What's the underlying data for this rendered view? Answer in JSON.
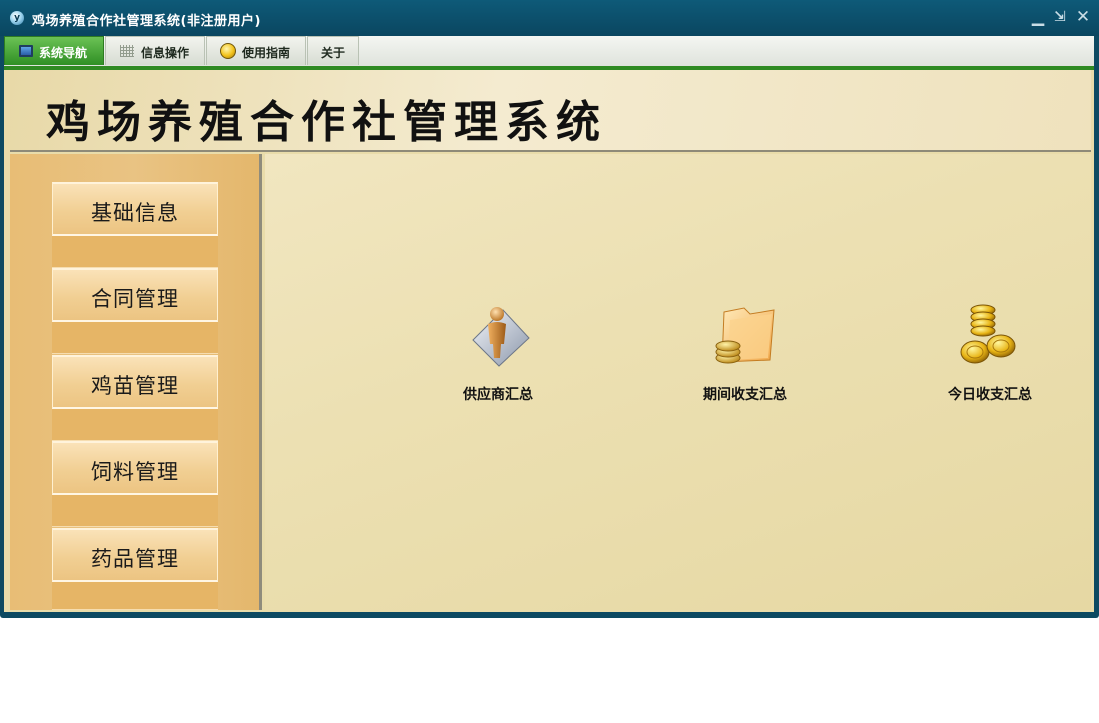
{
  "window": {
    "title": "鸡场养殖合作社管理系统(非注册用户)",
    "controls": {
      "minimize": "▁",
      "restore": "⇲",
      "close": "✕"
    }
  },
  "menu": {
    "tabs": [
      {
        "label": "系统导航",
        "icon": "monitor-icon",
        "active": true
      },
      {
        "label": "信息操作",
        "icon": "grid-icon",
        "active": false
      },
      {
        "label": "使用指南",
        "icon": "coin-icon",
        "active": false
      },
      {
        "label": "关于",
        "icon": "",
        "active": false
      }
    ]
  },
  "banner": {
    "title": "鸡场养殖合作社管理系统"
  },
  "sidebar": {
    "items": [
      {
        "label": "基础信息"
      },
      {
        "label": "合同管理"
      },
      {
        "label": "鸡苗管理"
      },
      {
        "label": "饲料管理"
      },
      {
        "label": "药品管理"
      }
    ]
  },
  "shortcuts": [
    {
      "label": "供应商汇总",
      "icon": "supplier-person-icon"
    },
    {
      "label": "期间收支汇总",
      "icon": "folder-coins-icon"
    },
    {
      "label": "今日收支汇总",
      "icon": "gold-coins-icon"
    }
  ],
  "colors": {
    "titlebar": "#0a4660",
    "active_tab": "#2f8f24",
    "content_bg": "#e9dcaa",
    "sidebar_bg": "#e8bd75"
  }
}
